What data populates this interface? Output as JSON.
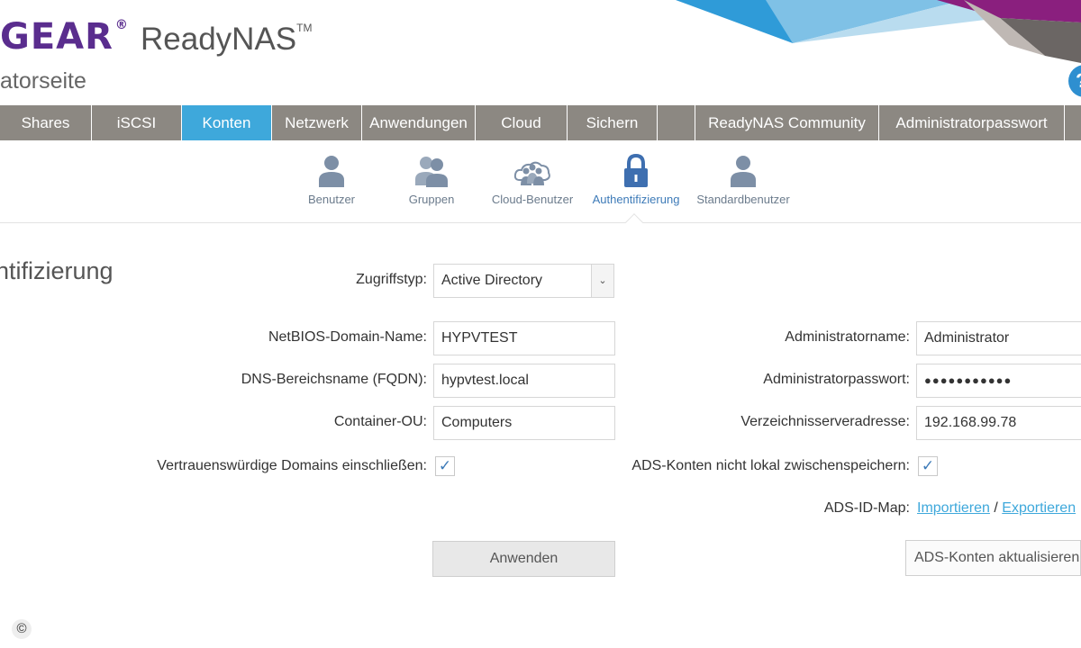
{
  "header": {
    "logo_text": "GEAR",
    "logo_mark": "®",
    "product": "ReadyNAS",
    "product_tm": "TM",
    "subtitle": "atorseite",
    "help_icon": "?"
  },
  "nav": {
    "tabs": [
      {
        "label": "Shares"
      },
      {
        "label": "iSCSI"
      },
      {
        "label": "Konten",
        "active": true
      },
      {
        "label": "Netzwerk"
      },
      {
        "label": "Anwendungen"
      },
      {
        "label": "Cloud"
      },
      {
        "label": "Sichern"
      },
      {
        "label": ""
      },
      {
        "label": "ReadyNAS Community"
      },
      {
        "label": "Administratorpasswort"
      }
    ]
  },
  "subnav": {
    "items": [
      {
        "label": "Benutzer",
        "icon": "user-icon"
      },
      {
        "label": "Gruppen",
        "icon": "group-icon"
      },
      {
        "label": "Cloud-Benutzer",
        "icon": "cloud-users-icon"
      },
      {
        "label": "Authentifizierung",
        "icon": "lock-icon",
        "active": true
      },
      {
        "label": "Standardbenutzer",
        "icon": "default-user-icon"
      }
    ]
  },
  "page": {
    "title": "ntifizierung"
  },
  "form": {
    "access_type_label": "Zugriffstyp:",
    "access_type_value": "Active Directory",
    "netbios_label": "NetBIOS-Domain-Name:",
    "netbios_value": "HYPVTEST",
    "dns_label": "DNS-Bereichsname (FQDN):",
    "dns_value": "hypvtest.local",
    "container_label": "Container-OU:",
    "container_value": "Computers",
    "trusted_label": "Vertrauenswürdige Domains einschließen:",
    "trusted_checked": true,
    "admin_name_label": "Administratorname:",
    "admin_name_value": "Administrator",
    "admin_pw_label": "Administratorpasswort:",
    "admin_pw_value": "●●●●●●●●●●●",
    "dir_server_label": "Verzeichnisserveradresse:",
    "dir_server_value": "192.168.99.78",
    "no_cache_label": "ADS-Konten nicht lokal zwischenspeichern:",
    "no_cache_checked": true,
    "idmap_label": "ADS-ID-Map:",
    "import_link": "Importieren",
    "separator": "/",
    "export_link": "Exportieren",
    "apply_button": "Anwenden",
    "refresh_button": "ADS-Konten aktualisieren",
    "check_glyph": "✓"
  },
  "footer": {
    "copyright": "©"
  },
  "colors": {
    "brand_purple": "#5a2d8e",
    "nav_gray": "#8c8882",
    "active_blue": "#3ea8db",
    "icon_slate": "#7d8fa6"
  }
}
